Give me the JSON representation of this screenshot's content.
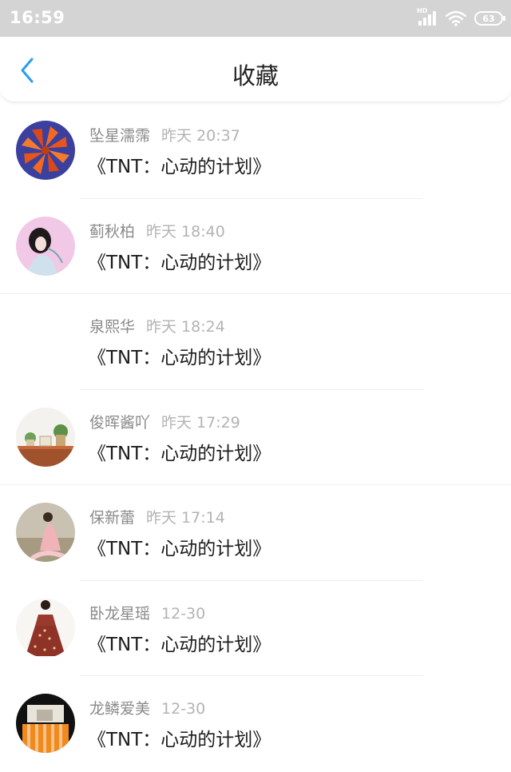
{
  "status_bar": {
    "time": "16:59",
    "network_label": "HD",
    "battery": "63",
    "icons": [
      "signal-icon",
      "wifi-icon",
      "battery-icon"
    ]
  },
  "header": {
    "title": "收藏",
    "back_icon": "chevron-left-icon",
    "accent_color": "#2a9df4"
  },
  "favorites": [
    {
      "name": "坠星濡霈",
      "time": "昨天 20:37",
      "title": "《TNT：心动的计划》",
      "avatar": "orange-flower-avatar"
    },
    {
      "name": "蓟秋柏",
      "time": "昨天 18:40",
      "title": "《TNT：心动的计划》",
      "avatar": "girl-pink-avatar"
    },
    {
      "name": "泉熙华",
      "time": "昨天 18:24",
      "title": "《TNT：心动的计划》",
      "avatar": "blank-avatar"
    },
    {
      "name": "俊晖酱吖",
      "time": "昨天 17:29",
      "title": "《TNT：心动的计划》",
      "avatar": "plants-shelf-avatar"
    },
    {
      "name": "保新蕾",
      "time": "昨天 17:14",
      "title": "《TNT：心动的计划》",
      "avatar": "girl-field-avatar"
    },
    {
      "name": "卧龙星瑶",
      "time": "12-30",
      "title": "《TNT：心动的计划》",
      "avatar": "red-dress-avatar"
    },
    {
      "name": "龙鳞爱美",
      "time": "12-30",
      "title": "《TNT：心动的计划》",
      "avatar": "orange-stripes-avatar"
    }
  ]
}
